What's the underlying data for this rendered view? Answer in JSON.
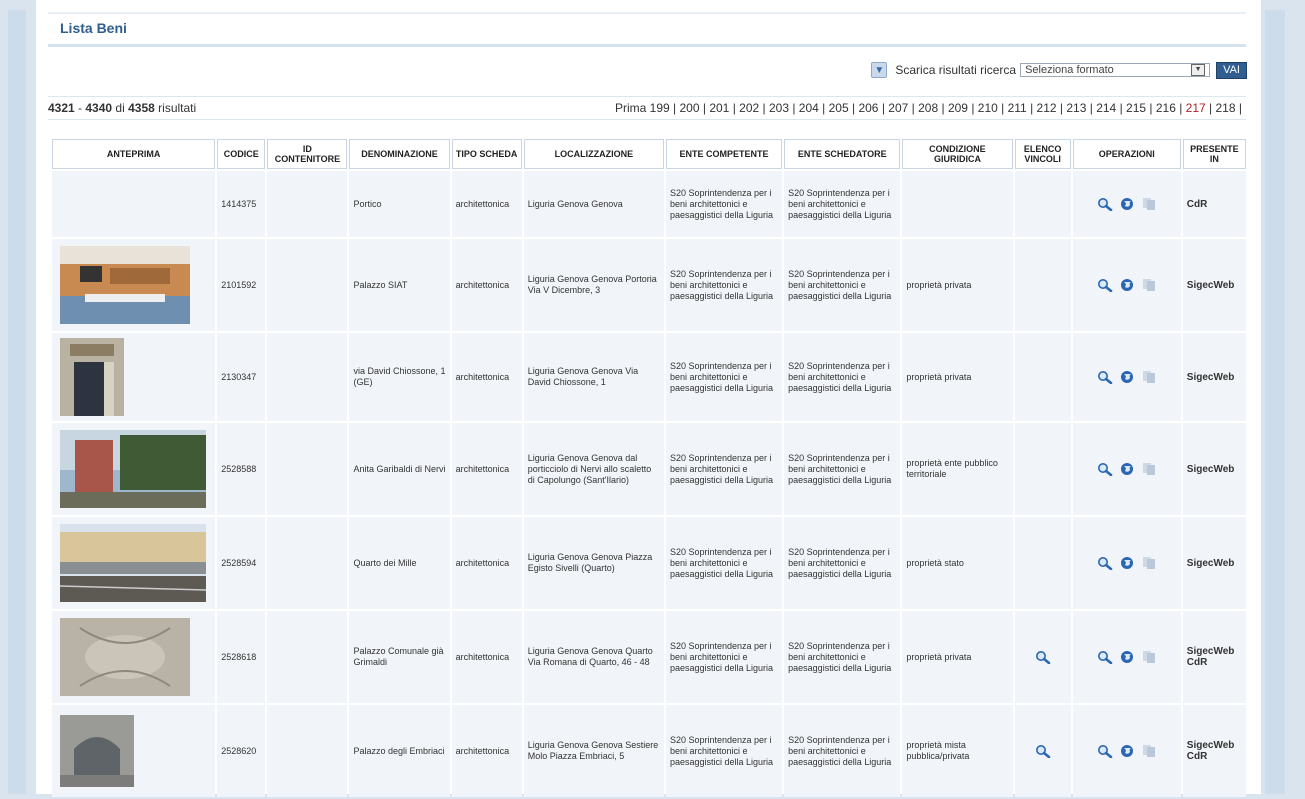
{
  "header": {
    "title": "Lista Beni"
  },
  "download": {
    "label": "Scarica risultati ricerca",
    "select_value": "Seleziona formato",
    "go_label": "VAI"
  },
  "results": {
    "from": "4321",
    "to": "4340",
    "of_word": "di",
    "total": "4358",
    "suffix": "risultati"
  },
  "pager": {
    "first": "Prima",
    "pages": [
      "199",
      "200",
      "201",
      "202",
      "203",
      "204",
      "205",
      "206",
      "207",
      "208",
      "209",
      "210",
      "211",
      "212",
      "213",
      "214",
      "215",
      "216",
      "217",
      "218"
    ],
    "current": "217"
  },
  "columns": [
    "ANTEPRIMA",
    "CODICE",
    "ID CONTENITORE",
    "DENOMINAZIONE",
    "TIPO SCHEDA",
    "LOCALIZZAZIONE",
    "ENTE COMPETENTE",
    "ENTE SCHEDATORE",
    "CONDIZIONE GIURIDICA",
    "ELENCO VINCOLI",
    "OPERAZIONI",
    "PRESENTE IN"
  ],
  "rows": [
    {
      "thumb": "none",
      "codice": "1414375",
      "id_contenitore": "",
      "denominazione": "Portico",
      "tipo": "architettonica",
      "localizzazione": "Liguria Genova Genova",
      "ente_competente": "S20 Soprintendenza per i beni architettonici e paesaggistici della Liguria",
      "ente_schedatore": "S20 Soprintendenza per i beni architettonici e paesaggistici della Liguria",
      "condizione": "",
      "vincoli": false,
      "presente": "CdR"
    },
    {
      "thumb": "interior-meeting-room",
      "codice": "2101592",
      "id_contenitore": "",
      "denominazione": "Palazzo SIAT",
      "tipo": "architettonica",
      "localizzazione": "Liguria Genova Genova Portoria Via V Dicembre, 3",
      "ente_competente": "S20 Soprintendenza per i beni architettonici e paesaggistici della Liguria",
      "ente_schedatore": "S20 Soprintendenza per i beni architettonici e paesaggistici della Liguria",
      "condizione": "proprietà privata",
      "vincoli": false,
      "presente": "SigecWeb"
    },
    {
      "thumb": "doorway",
      "codice": "2130347",
      "id_contenitore": "",
      "denominazione": "via David Chiossone, 1 (GE)",
      "tipo": "architettonica",
      "localizzazione": "Liguria Genova Genova Via David Chiossone, 1",
      "ente_competente": "S20 Soprintendenza per i beni architettonici e paesaggistici della Liguria",
      "ente_schedatore": "S20 Soprintendenza per i beni architettonici e paesaggistici della Liguria",
      "condizione": "proprietà privata",
      "vincoli": false,
      "presente": "SigecWeb"
    },
    {
      "thumb": "tower",
      "codice": "2528588",
      "id_contenitore": "",
      "denominazione": "Anita Garibaldi di Nervi",
      "tipo": "architettonica",
      "localizzazione": "Liguria Genova Genova dal porticciolo di Nervi allo scaletto di Capolungo (Sant'Ilario)",
      "ente_competente": "S20 Soprintendenza per i beni architettonici e paesaggistici della Liguria",
      "ente_schedatore": "S20 Soprintendenza per i beni architettonici e paesaggistici della Liguria",
      "condizione": "proprietà ente pubblico territoriale",
      "vincoli": false,
      "presente": "SigecWeb"
    },
    {
      "thumb": "station",
      "codice": "2528594",
      "id_contenitore": "",
      "denominazione": "Quarto dei Mille",
      "tipo": "architettonica",
      "localizzazione": "Liguria Genova Genova Piazza Egisto Sivelli (Quarto)",
      "ente_competente": "S20 Soprintendenza per i beni architettonici e paesaggistici della Liguria",
      "ente_schedatore": "S20 Soprintendenza per i beni architettonici e paesaggistici della Liguria",
      "condizione": "proprietà stato",
      "vincoli": false,
      "presente": "SigecWeb"
    },
    {
      "thumb": "ceiling",
      "codice": "2528618",
      "id_contenitore": "",
      "denominazione": "Palazzo Comunale già Grimaldi",
      "tipo": "architettonica",
      "localizzazione": "Liguria Genova Genova Quarto Via Romana di Quarto, 46 - 48",
      "ente_competente": "S20 Soprintendenza per i beni architettonici e paesaggistici della Liguria",
      "ente_schedatore": "S20 Soprintendenza per i beni architettonici e paesaggistici della Liguria",
      "condizione": "proprietà privata",
      "vincoli": true,
      "presente": "SigecWeb CdR"
    },
    {
      "thumb": "arch",
      "codice": "2528620",
      "id_contenitore": "",
      "denominazione": "Palazzo degli Embriaci",
      "tipo": "architettonica",
      "localizzazione": "Liguria Genova Genova Sestiere Molo Piazza Embriaci, 5",
      "ente_competente": "S20 Soprintendenza per i beni architettonici e paesaggistici della Liguria",
      "ente_schedatore": "S20 Soprintendenza per i beni architettonici e paesaggistici della Liguria",
      "condizione": "proprietà mista pubblica/privata",
      "vincoli": true,
      "presente": "SigecWeb CdR"
    }
  ],
  "icons": {
    "view": "magnifier-icon",
    "globe": "globe-icon",
    "copy": "copy-icon"
  },
  "colors": {
    "accent": "#2f5e8f",
    "current_page": "#b0232a",
    "row_bg": "#f1f4f8"
  }
}
